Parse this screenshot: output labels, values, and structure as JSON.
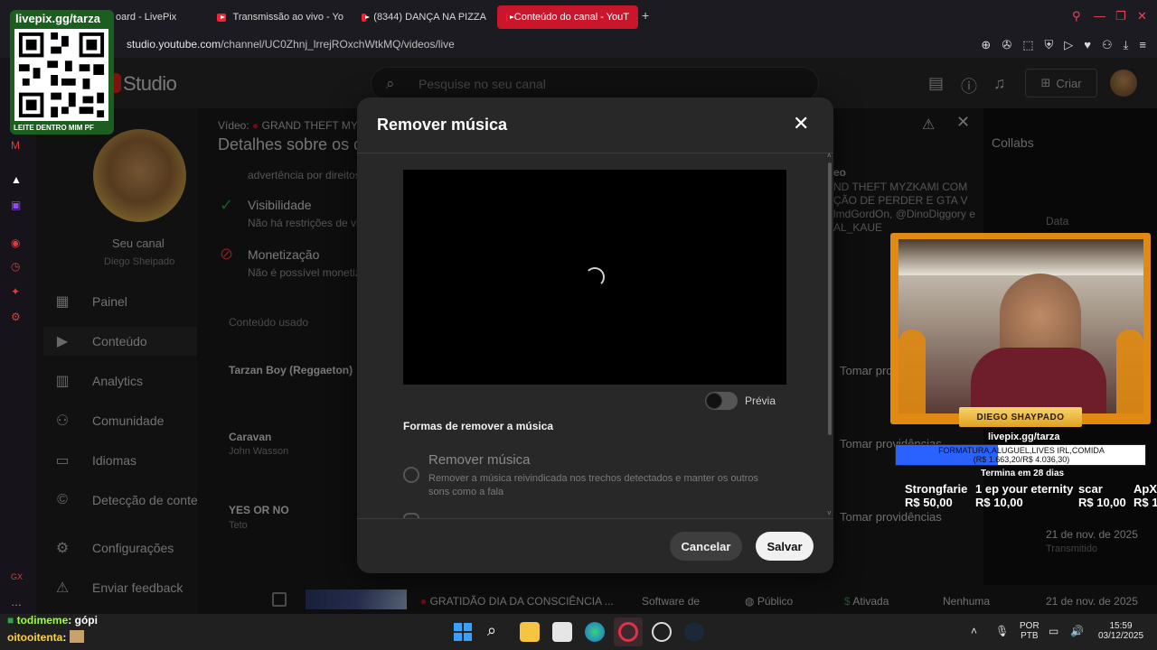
{
  "browser": {
    "tabs": [
      {
        "label": "oard - LivePix"
      },
      {
        "label": "Transmissão ao vivo - Yo"
      },
      {
        "label": "(8344) DANÇA NA PIZZA"
      },
      {
        "label": "Conteúdo do canal - YouT"
      }
    ],
    "new_tab": "+",
    "url_prefix": "studio.youtube.com",
    "url_path": "/channel/UC0Zhnj_lrrejROxchWtkMQ/videos/live"
  },
  "studio": {
    "logo": "Studio",
    "search_placeholder": "Pesquise no seu canal",
    "create_label": "Criar",
    "channel": {
      "name": "Seu canal",
      "handle": "Diego Sheipado"
    },
    "nav": [
      {
        "label": "Painel"
      },
      {
        "label": "Conteúdo"
      },
      {
        "label": "Analytics"
      },
      {
        "label": "Comunidade"
      },
      {
        "label": "Idiomas"
      },
      {
        "label": "Detecção de conte"
      },
      {
        "label": "Configurações"
      },
      {
        "label": "Enviar feedback"
      }
    ]
  },
  "details": {
    "video_prefix": "Vídeo:",
    "video_name": "GRAND THEFT MYZ",
    "title": "Detalhes sobre os d",
    "warning_line": "advertência por direitos",
    "visibility_title": "Visibilidade",
    "visibility_desc": "Não há restrições de vi",
    "monetization_title": "Monetização",
    "monetization_desc": "Não é possível monetiz",
    "used_content_header": "Conteúdo usado",
    "songs": [
      {
        "title": "Tarzan Boy (Reggaeton)",
        "artist": ""
      },
      {
        "title": "Caravan",
        "artist": "John Wasson"
      },
      {
        "title": "YES OR NO",
        "artist": "Teto"
      }
    ],
    "collabs": "Collabs",
    "date_header": "Data",
    "right_heading": "eo",
    "right_desc_lines": [
      "ND THEFT MYZKAMI COM",
      "ÇÃO DE PERDER E GTA V",
      "lmdGordOn, @DinoDiggory e",
      "AL_KAUE"
    ],
    "take_action": [
      "Tomar pro",
      "Tomar providências",
      "Tomar providências"
    ],
    "rows_dates": [
      {
        "date": "21 de nov. de 2025",
        "status": "Transmitido"
      },
      {
        "date": "21 de nov. de 2025",
        "status": "Transmitido"
      }
    ],
    "bottom_row": {
      "title": "GRATIDÃO DIA DA CONSCIÊNCIA ...",
      "source": "Software de",
      "visibility": "Público",
      "monetization": "Ativada",
      "restrictions": "Nenhuma",
      "date": "21 de nov. de 2025"
    }
  },
  "modal": {
    "title": "Remover música",
    "preview_label": "Prévia",
    "section_label": "Formas de remover a música",
    "option1_title": "Remover música",
    "option1_desc": "Remover a música reivindicada nos trechos detectados e manter os outros sons como a fala",
    "cancel_label": "Cancelar",
    "save_label": "Salvar"
  },
  "overlay": {
    "qr_header": "livepix.gg/tarza",
    "qr_footer": "LEITE DENTRO MIM PF",
    "cam_name": "DIEGO SHAYPADO",
    "goal_url": "livepix.gg/tarza",
    "goal_text_1": "FORMATURA,ALUGUEL,LIVES IRL,COMIDA",
    "goal_text_2": "(R$ 1.663,20/R$ 4.036,30)",
    "goal_progress": 0.41,
    "goal_ends": "Termina em 28 dias",
    "donors": [
      {
        "name": "Strongfarie",
        "amount": "R$ 50,00"
      },
      {
        "name": "1 ep your eternity",
        "amount": "R$ 10,00"
      },
      {
        "name": "scar",
        "amount": "R$ 10,00"
      },
      {
        "name": "ApXS",
        "amount": "R$ 1"
      }
    ],
    "chat": [
      {
        "user": "todimeme",
        "msg": "gópi",
        "color": "#9bff3c"
      },
      {
        "user": "oitooitenta",
        "msg": "",
        "color": "#ffd23c"
      }
    ]
  },
  "taskbar": {
    "lang_1": "POR",
    "lang_2": "PTB",
    "time": "15:59",
    "date": "03/12/2025"
  },
  "colors": {
    "accent": "#c9162b",
    "yt_red": "#ff1f2d",
    "modal_bg": "#282828"
  }
}
